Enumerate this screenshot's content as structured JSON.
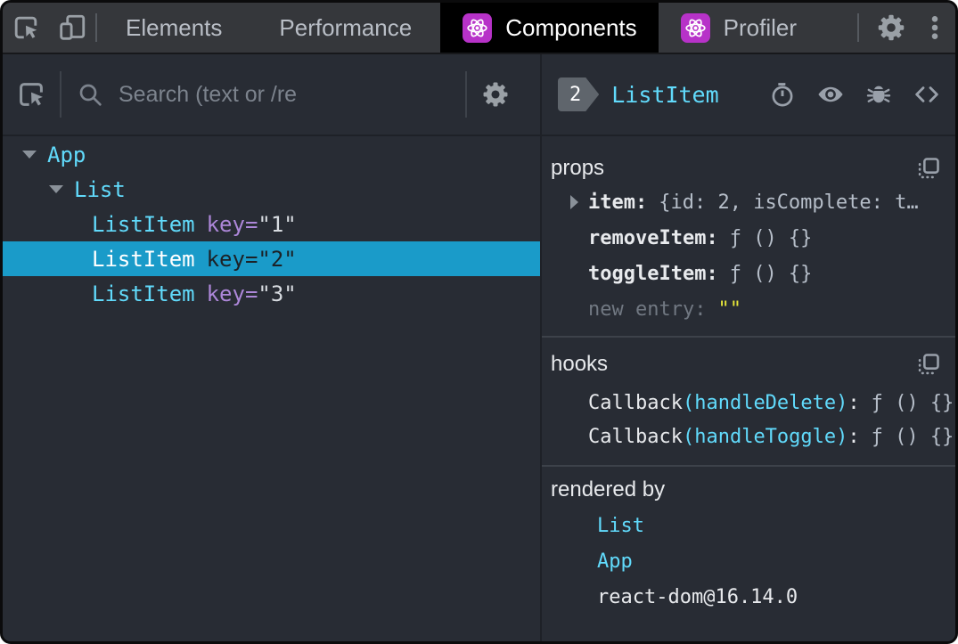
{
  "colors": {
    "accent_cyan": "#61dafb",
    "attr_purple": "#ad87d9",
    "selected_row_bg": "#1a9bc9",
    "react_icon_purple": "#b732c8",
    "value_yellow": "#e8e839",
    "panel_bg": "#282c34",
    "topbar_bg": "#35373b",
    "active_tab_bg": "#000000"
  },
  "topbar": {
    "tabs": [
      {
        "label": "Elements"
      },
      {
        "label": "Performance"
      },
      {
        "label": "Components"
      },
      {
        "label": "Profiler"
      }
    ]
  },
  "left_panel": {
    "search_placeholder": "Search (text or /re",
    "tree": {
      "rows": [
        {
          "name": "App"
        },
        {
          "name": "List"
        },
        {
          "name": "ListItem",
          "attr": "key=",
          "value": "\"1\""
        },
        {
          "name": "ListItem",
          "attr": "key=",
          "value": "\"2\""
        },
        {
          "name": "ListItem",
          "attr": "key=",
          "value": "\"3\""
        }
      ]
    }
  },
  "right_panel": {
    "header": {
      "badge": "2",
      "component": "ListItem"
    },
    "props": {
      "title": "props",
      "rows": [
        {
          "label": "item:",
          "value": "{id: 2, isComplete: t…"
        },
        {
          "label": "removeItem:",
          "value": "ƒ () {}"
        },
        {
          "label": "toggleItem:",
          "value": "ƒ () {}"
        },
        {
          "label": "new entry:",
          "value": "\"\""
        }
      ]
    },
    "hooks": {
      "title": "hooks",
      "rows": [
        {
          "label": "Callback",
          "detail": "(handleDelete)",
          "sep": ":",
          "value": "ƒ () {}"
        },
        {
          "label": "Callback",
          "detail": "(handleToggle)",
          "sep": ":",
          "value": "ƒ () {}"
        }
      ]
    },
    "rendered_by": {
      "title": "rendered by",
      "items": [
        {
          "label": "List"
        },
        {
          "label": "App"
        },
        {
          "label": "react-dom@16.14.0"
        }
      ]
    }
  }
}
